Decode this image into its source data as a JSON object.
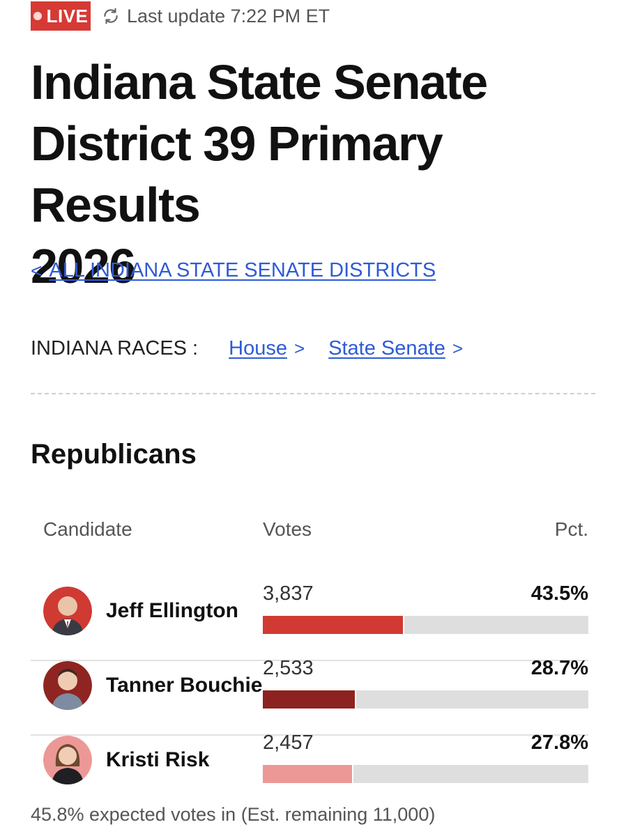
{
  "header": {
    "live_label": "LIVE",
    "update_text": "Last update 7:22 PM ET",
    "icons": {
      "live": "live-dot-icon",
      "refresh": "refresh-icon"
    }
  },
  "title_lines": [
    "Indiana State Senate",
    "District 39 Primary Results",
    "2026"
  ],
  "back_link": {
    "chevron": "<",
    "label": "ALL INDIANA STATE SENATE DISTRICTS"
  },
  "races": {
    "label": "INDIANA RACES :",
    "links": [
      {
        "label": "House",
        "chevron": ">"
      },
      {
        "label": "State Senate",
        "chevron": ">"
      }
    ]
  },
  "party": "Republicans",
  "table": {
    "headers": {
      "candidate": "Candidate",
      "votes": "Votes",
      "pct": "Pct."
    },
    "rows": [
      {
        "name": "Jeff Ellington",
        "votes": "3,837",
        "pct": "43.5%",
        "share": 0.435,
        "color": "#d13a32",
        "avatar_bg": "#cf3a33"
      },
      {
        "name": "Tanner Bouchie",
        "votes": "2,533",
        "pct": "28.7%",
        "share": 0.287,
        "color": "#8c2320",
        "avatar_bg": "#8e2522"
      },
      {
        "name": "Kristi Risk",
        "votes": "2,457",
        "pct": "27.8%",
        "share": 0.278,
        "color": "#ec9896",
        "avatar_bg": "#ec9896"
      }
    ]
  },
  "footer": "45.8% expected votes in (Est. remaining 11,000)",
  "colors": {
    "live": "#d63a35",
    "link": "#2e5bd6",
    "track": "#dedede"
  }
}
